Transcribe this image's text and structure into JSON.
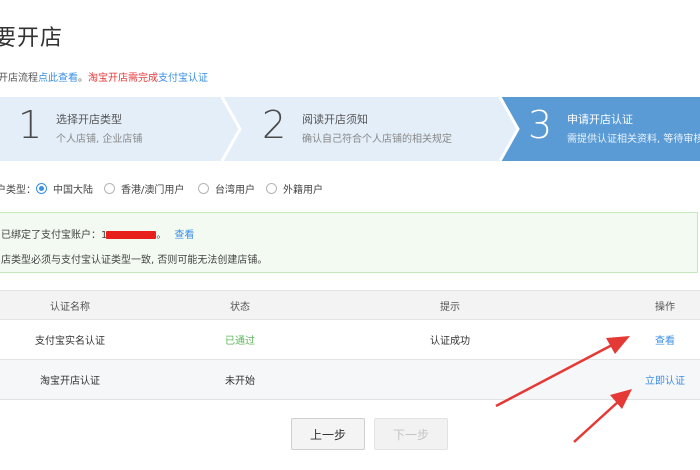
{
  "page": {
    "title": "要开店"
  },
  "notice": {
    "text1": "开店流程",
    "link1": "点此查看",
    "text2": "。",
    "red_text": "淘宝开店需完成",
    "link2": "支付宝认证"
  },
  "steps": [
    {
      "num": "1",
      "title": "选择开店类型",
      "sub": "个人店铺, 企业店铺",
      "state": "done"
    },
    {
      "num": "2",
      "title": "阅读开店须知",
      "sub": "确认自己符合个人店铺的相关规定",
      "state": "done"
    },
    {
      "num": "3",
      "title": "申请开店认证",
      "sub": "需提供认证相关资料, 等待审核",
      "state": "active"
    }
  ],
  "step_colors": {
    "inactive": "#e4eef9",
    "active": "#5b9bd5",
    "divider": "#ffffff"
  },
  "seller_type": {
    "label": "户类型：",
    "options": [
      {
        "label": "中国大陆",
        "checked": true
      },
      {
        "label": "香港/澳门用户",
        "checked": false
      },
      {
        "label": "台湾用户",
        "checked": false
      },
      {
        "label": "外籍用户",
        "checked": false
      }
    ]
  },
  "info": {
    "line1_prefix": "已绑定了支付宝账户：1",
    "line1_suffix": "。",
    "view_link": "查看",
    "line2": "店类型必须与支付宝认证类型一致, 否则可能无法创建店铺。"
  },
  "table": {
    "headers": [
      "认证名称",
      "状态",
      "提示",
      "操作"
    ],
    "rows": [
      {
        "name": "支付宝实名认证",
        "status": "已通过",
        "hint": "认证成功",
        "action": "查看"
      },
      {
        "name": "淘宝开店认证",
        "status": "未开始",
        "hint": "",
        "action": "立即认证"
      }
    ]
  },
  "buttons": {
    "prev": "上一步",
    "next": "下一步"
  },
  "annotations": {
    "arrow_color": "#e53935"
  }
}
